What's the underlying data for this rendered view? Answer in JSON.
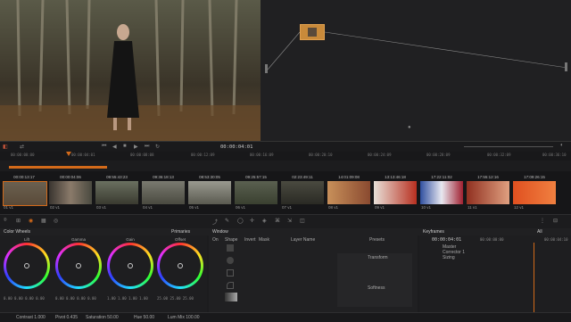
{
  "transport": {
    "timecode": "00:00:04:01"
  },
  "ruler_ticks": [
    "00:00:00:00",
    "00:00:04:01",
    "00:00:08:08",
    "00:00:12:09",
    "00:00:16:09",
    "00:00:20:10",
    "00:00:24:09",
    "00:00:28:09",
    "00:00:32:09",
    "00:00:36:10",
    "00:00:40:11",
    "00:00:44:09",
    "00:00:48:09",
    "00:00:52:09"
  ],
  "clips": [
    {
      "tc": "00:00:13:17",
      "label": "01  v1"
    },
    {
      "tc": "00:00:04:06",
      "label": "02  v1"
    },
    {
      "tc": "09:55:43:23",
      "label": "03  v1"
    },
    {
      "tc": "09:36:18:13",
      "label": "04  v1"
    },
    {
      "tc": "08:53:30:05",
      "label": "05  v1"
    },
    {
      "tc": "09:25:57:15",
      "label": "06  v1"
    },
    {
      "tc": "02:23:49:11",
      "label": "07  v1"
    },
    {
      "tc": "14:01:09:08",
      "label": "08  v1"
    },
    {
      "tc": "13:13:46:18",
      "label": "09  v1"
    },
    {
      "tc": "17:22:11:02",
      "label": "10  v1"
    },
    {
      "tc": "17:55:12:16",
      "label": "11  v1"
    },
    {
      "tc": "17:09:26:15",
      "label": "12  v1"
    }
  ],
  "panels": {
    "color_wheels": "Color Wheels",
    "primaries": "Primaries",
    "window": "Window",
    "keyframes": "Keyframes",
    "all": "All"
  },
  "wheels": [
    {
      "name": "Lift",
      "vals": "0.00  0.00  0.00  0.00"
    },
    {
      "name": "Gamma",
      "vals": "0.00  0.00  0.00  0.00"
    },
    {
      "name": "Gain",
      "vals": "1.00  1.00  1.00  1.00"
    },
    {
      "name": "Offset",
      "vals": "25.00  25.00  25.00"
    }
  ],
  "window_panel": {
    "cols": [
      "On",
      "Shape",
      "Invert",
      "Mask",
      "Layer Name",
      "Presets"
    ],
    "transform": "Transform",
    "softness": "Softness"
  },
  "keyframes": {
    "timecode": "00:00:04:01",
    "tc2": "00:00:00:00",
    "tc3": "00:00:04:10",
    "rows": [
      "Master",
      "Corrector 1",
      "Sizing"
    ]
  },
  "bottom": {
    "contrast": "Contrast  1.000",
    "pivot": "Pivot  0.435",
    "saturation": "Saturation  50.00",
    "hue": "Hue  50.00",
    "lummix": "Lum Mix  100.00"
  }
}
